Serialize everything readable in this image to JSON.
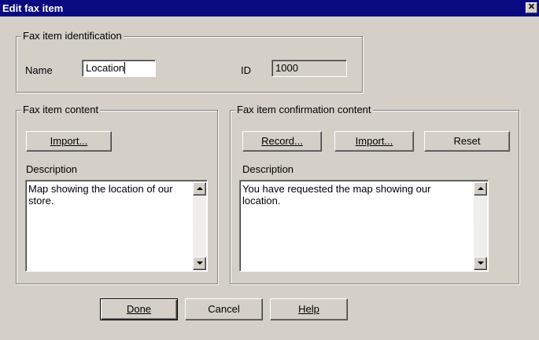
{
  "window": {
    "title": "Edit fax item",
    "close_glyph": "✕"
  },
  "identification": {
    "group_label": "Fax item identification",
    "name_label": "Name",
    "name_value": "Location",
    "id_label": "ID",
    "id_value": "1000"
  },
  "content": {
    "group_label": "Fax item content",
    "import_button": "Import...",
    "description_label": "Description",
    "description_text": "Map showing the location of our store."
  },
  "confirmation": {
    "group_label": "Fax item confirmation content",
    "record_button": "Record...",
    "import_button": "Import...",
    "reset_button": "Reset",
    "description_label": "Description",
    "description_text": "You have requested the map showing our location."
  },
  "footer": {
    "done_button": "Done",
    "cancel_button": "Cancel",
    "help_button": "Help"
  },
  "colors": {
    "titlebar": "#0a0a80",
    "dialog_face": "#d4d0c8"
  }
}
